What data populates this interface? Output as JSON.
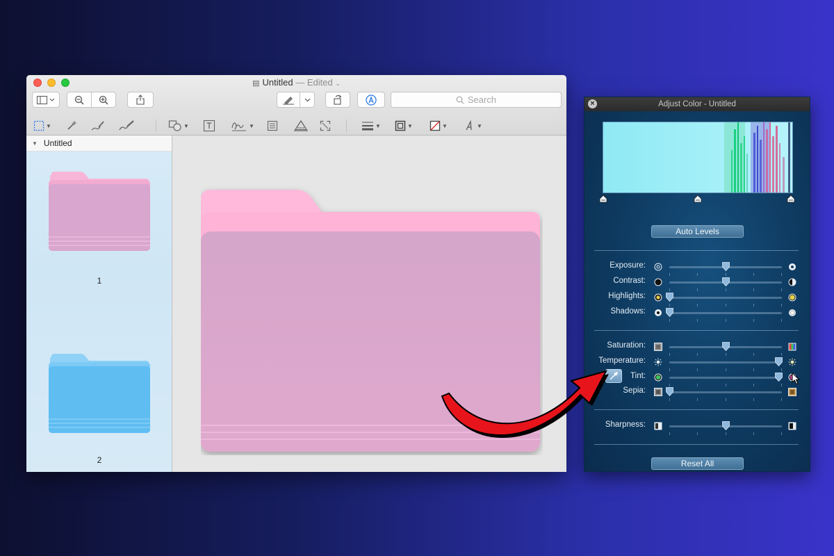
{
  "window": {
    "title": "Untitled",
    "edited": "— Edited",
    "search_placeholder": "Search"
  },
  "sidebar": {
    "header": "Untitled",
    "pages": [
      {
        "label": "1",
        "folder_color": "#f2b0d6"
      },
      {
        "label": "2",
        "folder_color": "#5fbdf2"
      }
    ]
  },
  "canvas": {
    "folder_tab_color": "#ffb9da",
    "folder_body_color": "#d8a4cd"
  },
  "panel": {
    "title": "Adjust Color - Untitled",
    "auto_levels": "Auto Levels",
    "reset_all": "Reset All",
    "sliders": [
      {
        "label": "Exposure:",
        "value": 0.5
      },
      {
        "label": "Contrast:",
        "value": 0.5
      },
      {
        "label": "Highlights:",
        "value": 0.0
      },
      {
        "label": "Shadows:",
        "value": 0.0
      },
      {
        "label": "Saturation:",
        "value": 0.5
      },
      {
        "label": "Temperature:",
        "value": 0.97
      },
      {
        "label": "Tint:",
        "value": 0.97
      },
      {
        "label": "Sepia:",
        "value": 0.0
      },
      {
        "label": "Sharpness:",
        "value": 0.5
      }
    ]
  },
  "colors": {
    "annotation_arrow": "#e8141b",
    "panel_accent": "#5e8eb2"
  }
}
